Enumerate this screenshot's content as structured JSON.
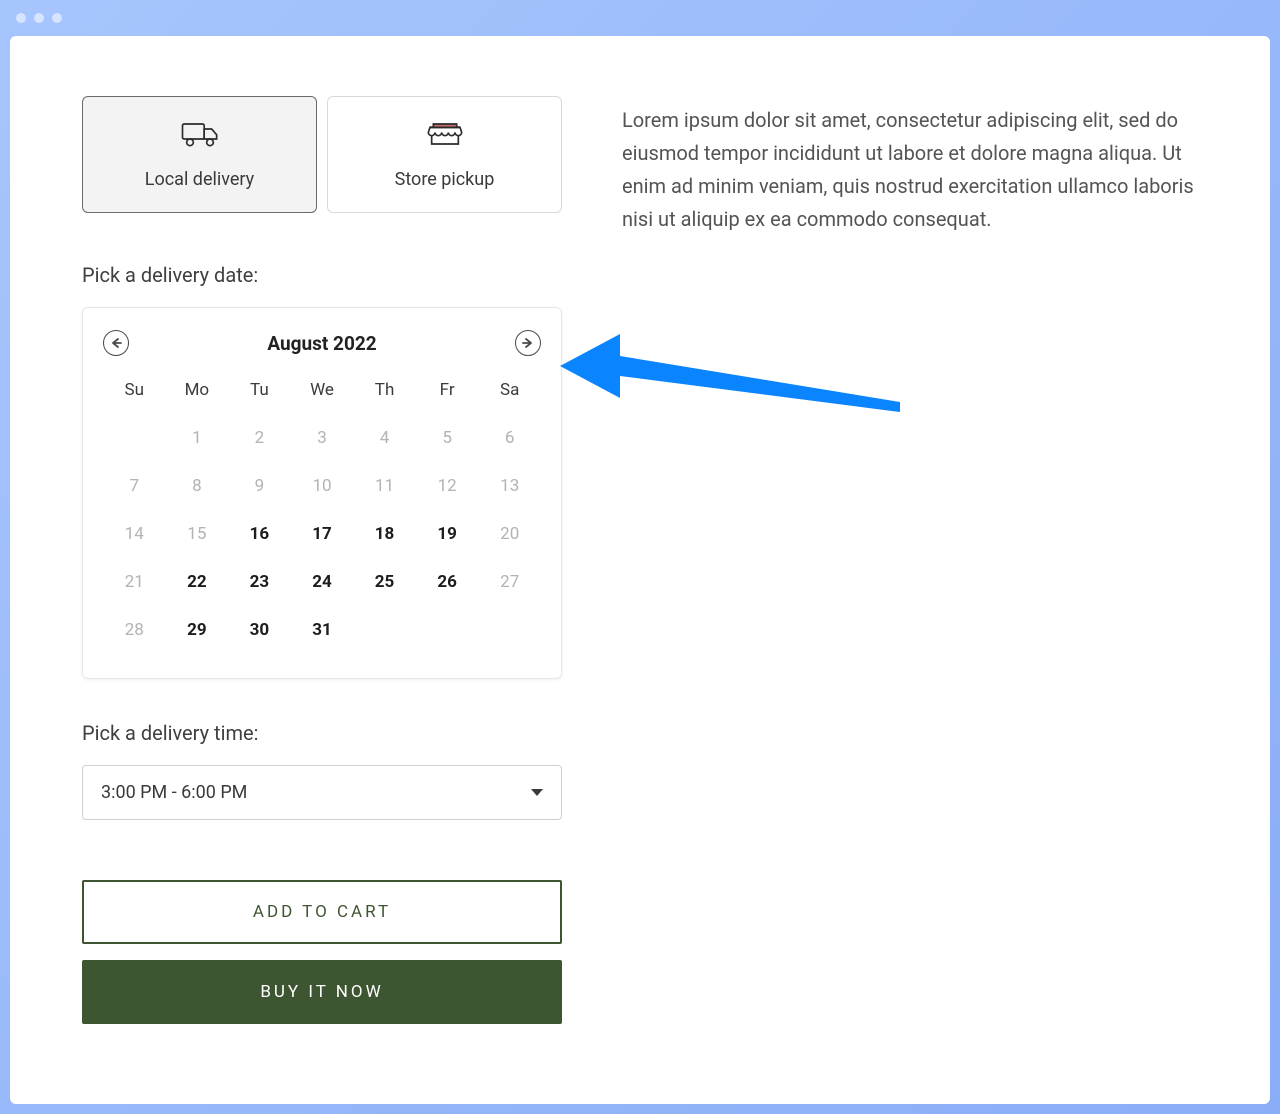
{
  "delivery": {
    "tabs": [
      {
        "label": "Local delivery",
        "selected": true
      },
      {
        "label": "Store pickup",
        "selected": false
      }
    ],
    "date_label": "Pick a delivery date:",
    "time_label": "Pick a delivery time:",
    "selected_time": "3:00 PM - 6:00 PM"
  },
  "calendar": {
    "month_title": "August 2022",
    "weekdays": [
      "Su",
      "Mo",
      "Tu",
      "We",
      "Th",
      "Fr",
      "Sa"
    ],
    "days": [
      {
        "n": "",
        "enabled": false
      },
      {
        "n": "1",
        "enabled": false
      },
      {
        "n": "2",
        "enabled": false
      },
      {
        "n": "3",
        "enabled": false
      },
      {
        "n": "4",
        "enabled": false
      },
      {
        "n": "5",
        "enabled": false
      },
      {
        "n": "6",
        "enabled": false
      },
      {
        "n": "7",
        "enabled": false
      },
      {
        "n": "8",
        "enabled": false
      },
      {
        "n": "9",
        "enabled": false
      },
      {
        "n": "10",
        "enabled": false
      },
      {
        "n": "11",
        "enabled": false
      },
      {
        "n": "12",
        "enabled": false
      },
      {
        "n": "13",
        "enabled": false
      },
      {
        "n": "14",
        "enabled": false
      },
      {
        "n": "15",
        "enabled": false
      },
      {
        "n": "16",
        "enabled": true
      },
      {
        "n": "17",
        "enabled": true
      },
      {
        "n": "18",
        "enabled": true
      },
      {
        "n": "19",
        "enabled": true
      },
      {
        "n": "20",
        "enabled": false
      },
      {
        "n": "21",
        "enabled": false
      },
      {
        "n": "22",
        "enabled": true
      },
      {
        "n": "23",
        "enabled": true
      },
      {
        "n": "24",
        "enabled": true
      },
      {
        "n": "25",
        "enabled": true
      },
      {
        "n": "26",
        "enabled": true
      },
      {
        "n": "27",
        "enabled": false
      },
      {
        "n": "28",
        "enabled": false
      },
      {
        "n": "29",
        "enabled": true
      },
      {
        "n": "30",
        "enabled": true
      },
      {
        "n": "31",
        "enabled": true
      }
    ]
  },
  "buttons": {
    "add_to_cart": "Add to Cart",
    "buy_now": "Buy It Now"
  },
  "description": "Lorem ipsum dolor sit amet, consectetur adipiscing elit, sed do eiusmod tempor incididunt ut labore et dolore magna aliqua. Ut enim ad minim veniam, quis nostrud exercitation ullamco laboris nisi ut aliquip ex ea commodo consequat.",
  "colors": {
    "accent": "#3d5531",
    "annotation_arrow": "#0a84ff"
  }
}
